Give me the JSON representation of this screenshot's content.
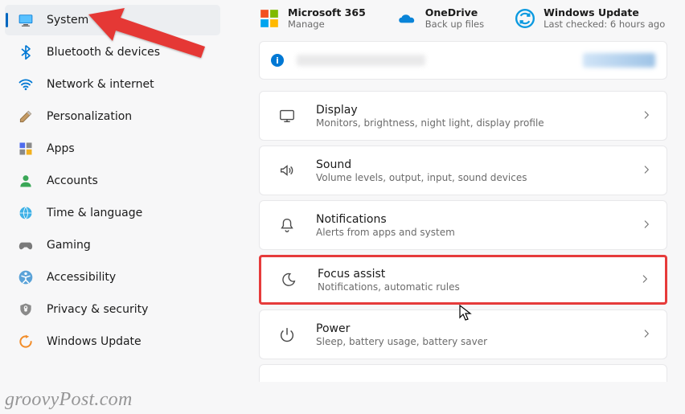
{
  "sidebar": {
    "items": [
      {
        "label": "System"
      },
      {
        "label": "Bluetooth & devices"
      },
      {
        "label": "Network & internet"
      },
      {
        "label": "Personalization"
      },
      {
        "label": "Apps"
      },
      {
        "label": "Accounts"
      },
      {
        "label": "Time & language"
      },
      {
        "label": "Gaming"
      },
      {
        "label": "Accessibility"
      },
      {
        "label": "Privacy & security"
      },
      {
        "label": "Windows Update"
      }
    ]
  },
  "top_cards": {
    "ms365": {
      "title": "Microsoft 365",
      "sub": "Manage"
    },
    "onedrive": {
      "title": "OneDrive",
      "sub": "Back up files"
    },
    "update": {
      "title": "Windows Update",
      "sub": "Last checked: 6 hours ago"
    }
  },
  "banner": {
    "info_glyph": "i"
  },
  "rows": {
    "display": {
      "title": "Display",
      "sub": "Monitors, brightness, night light, display profile"
    },
    "sound": {
      "title": "Sound",
      "sub": "Volume levels, output, input, sound devices"
    },
    "notifications": {
      "title": "Notifications",
      "sub": "Alerts from apps and system"
    },
    "focus": {
      "title": "Focus assist",
      "sub": "Notifications, automatic rules"
    },
    "power": {
      "title": "Power",
      "sub": "Sleep, battery usage, battery saver"
    }
  },
  "watermark": "groovyPost.com"
}
